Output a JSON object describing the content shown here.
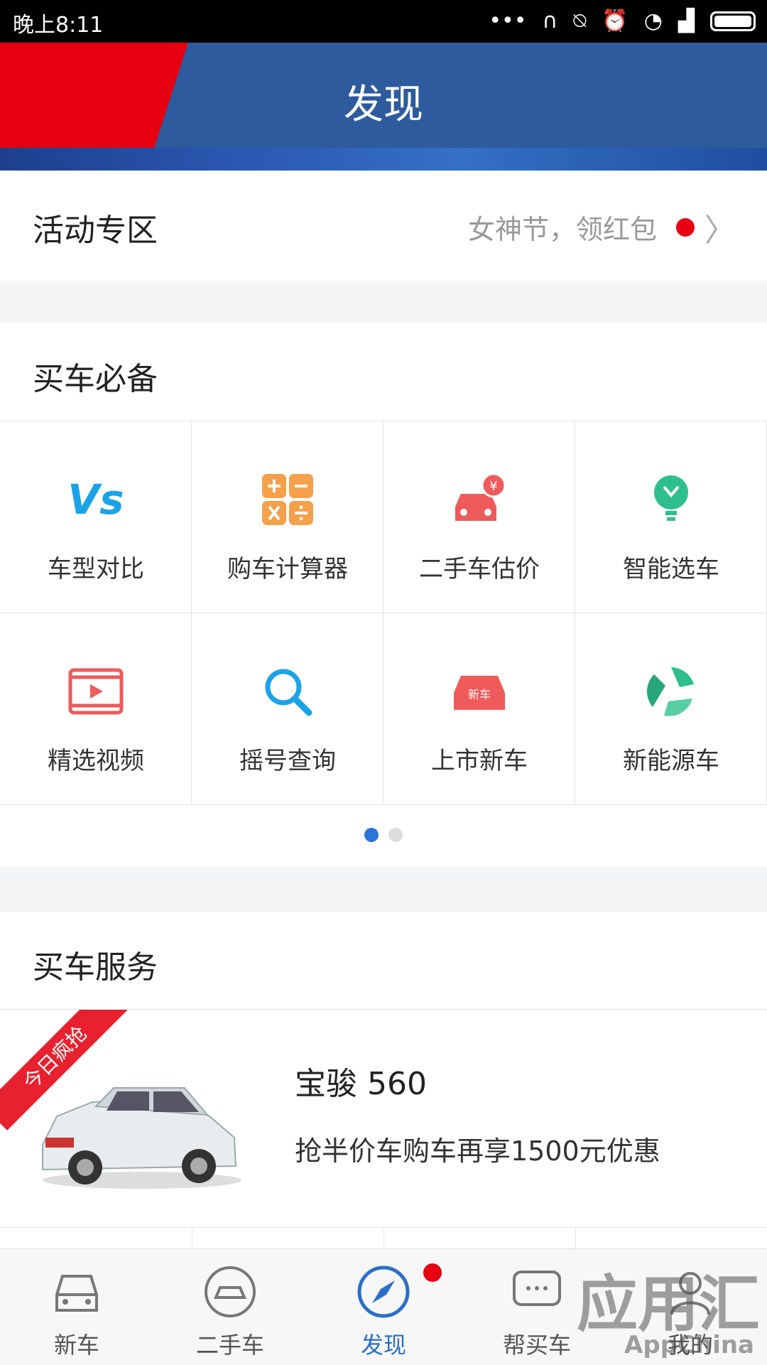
{
  "status_bar": {
    "time": "晚上8:11",
    "icons": [
      "more-icon",
      "headset-icon",
      "mute-icon",
      "alarm-icon",
      "wifi-icon",
      "signal-icon",
      "battery-icon"
    ]
  },
  "header": {
    "title": "发现",
    "accent_color": "#e60012",
    "bg_color": "#2d5b9e"
  },
  "activity": {
    "label": "活动专区",
    "promo": "女神节，领红包"
  },
  "essentials": {
    "title": "买车必备",
    "items": [
      {
        "label": "车型对比",
        "icon": "vs-icon"
      },
      {
        "label": "购车计算器",
        "icon": "calculator-icon"
      },
      {
        "label": "二手车估价",
        "icon": "car-price-icon"
      },
      {
        "label": "智能选车",
        "icon": "bulb-icon"
      },
      {
        "label": "精选视频",
        "icon": "video-icon"
      },
      {
        "label": "摇号查询",
        "icon": "search-icon"
      },
      {
        "label": "上市新车",
        "icon": "new-car-icon"
      },
      {
        "label": "新能源车",
        "icon": "eco-icon"
      }
    ],
    "page": 1,
    "pages": 2
  },
  "services": {
    "title": "买车服务",
    "ribbon": "今日疯抢",
    "car_name": "宝骏 560",
    "deal": "抢半价车购车再享1500元优惠"
  },
  "tabbar": {
    "items": [
      {
        "label": "新车",
        "icon": "car-front-icon"
      },
      {
        "label": "二手车",
        "icon": "used-car-icon"
      },
      {
        "label": "发现",
        "icon": "compass-icon"
      },
      {
        "label": "帮买车",
        "icon": "chat-icon"
      },
      {
        "label": "我的",
        "icon": "user-icon"
      }
    ],
    "active": "发现",
    "active_color": "#2a6fc9"
  },
  "watermark": {
    "cn": "应用汇",
    "en": "AppChina"
  }
}
